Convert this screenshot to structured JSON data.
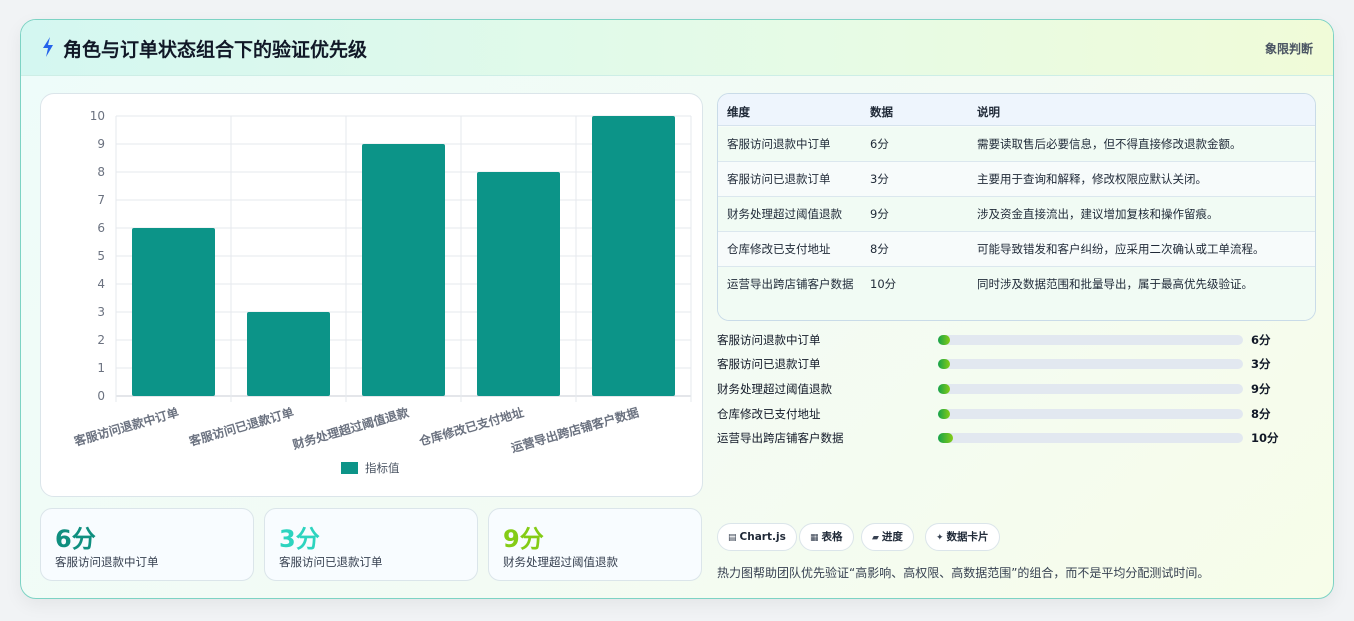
{
  "header": {
    "title": "角色与订单状态组合下的验证优先级",
    "tag": "象限判断"
  },
  "colors": {
    "bar": "#0c9488",
    "accent": "#0d9488",
    "teal_light": "#2dd4bf",
    "lime": "#84cc16"
  },
  "chart_data": {
    "type": "bar",
    "categories": [
      "客服访问退款中订单",
      "客服访问已退款订单",
      "财务处理超过阈值退款",
      "仓库修改已支付地址",
      "运营导出跨店铺客户数据"
    ],
    "series": [
      {
        "name": "指标值",
        "values": [
          6,
          3,
          9,
          8,
          10
        ]
      }
    ],
    "yticks": [
      "0",
      "1",
      "2",
      "3",
      "4",
      "5",
      "6",
      "7",
      "8",
      "9",
      "10"
    ],
    "ylim": [
      0,
      10
    ],
    "grid": true,
    "legend": "bottom"
  },
  "stats": [
    {
      "value": "6分",
      "label": "客服访问退款中订单",
      "color": "#0f8f7f"
    },
    {
      "value": "3分",
      "label": "客服访问已退款订单",
      "color": "#2dd4bf"
    },
    {
      "value": "9分",
      "label": "财务处理超过阈值退款",
      "color": "#84cc16"
    }
  ],
  "table": {
    "headers": [
      "维度",
      "数据",
      "说明"
    ],
    "rows": [
      {
        "dim": "客服访问退款中订单",
        "val": "6分",
        "desc": "需要读取售后必要信息，但不得直接修改退款金额。"
      },
      {
        "dim": "客服访问已退款订单",
        "val": "3分",
        "desc": "主要用于查询和解释，修改权限应默认关闭。"
      },
      {
        "dim": "财务处理超过阈值退款",
        "val": "9分",
        "desc": "涉及资金直接流出，建议增加复核和操作留痕。"
      },
      {
        "dim": "仓库修改已支付地址",
        "val": "8分",
        "desc": "可能导致错发和客户纠纷，应采用二次确认或工单流程。"
      },
      {
        "dim": "运营导出跨店铺客户数据",
        "val": "10分",
        "desc": "同时涉及数据范围和批量导出，属于最高优先级验证。"
      }
    ]
  },
  "progress": [
    {
      "label": "客服访问退款中订单",
      "value": "6分",
      "fraction": 0.04
    },
    {
      "label": "客服访问已退款订单",
      "value": "3分",
      "fraction": 0.04
    },
    {
      "label": "财务处理超过阈值退款",
      "value": "9分",
      "fraction": 0.04
    },
    {
      "label": "仓库修改已支付地址",
      "value": "8分",
      "fraction": 0.04
    },
    {
      "label": "运营导出跨店铺客户数据",
      "value": "10分",
      "fraction": 0.05
    }
  ],
  "chips": [
    {
      "icon": "chart-icon",
      "glyph": "▤",
      "label": "Chart.js"
    },
    {
      "icon": "table-icon",
      "glyph": "▦",
      "label": "表格"
    },
    {
      "icon": "progress-icon",
      "glyph": "▰",
      "label": "进度"
    },
    {
      "icon": "sparkle-icon",
      "glyph": "✦",
      "label": "数据卡片"
    }
  ],
  "footnote": "热力图帮助团队优先验证“高影响、高权限、高数据范围”的组合，而不是平均分配测试时间。"
}
